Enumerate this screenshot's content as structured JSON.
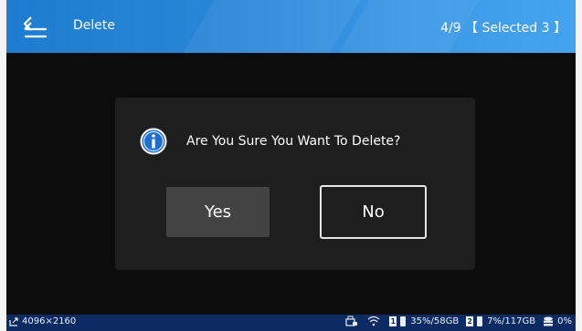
{
  "header": {
    "title": "Delete",
    "counter": "4/9",
    "selected": "【 Selected 3 】"
  },
  "dialog": {
    "message": "Are You Sure You Want To Delete?",
    "yes_label": "Yes",
    "no_label": "No",
    "icon": "info-icon"
  },
  "statusbar": {
    "resolution": "4096×2160",
    "slot1_number": "1",
    "slot1_usage": "35%/58GB",
    "slot2_number": "2",
    "slot2_usage": "7%/117GB",
    "storage_percent": "0%"
  },
  "colors": {
    "header_start": "#1e7ccf",
    "header_end": "#45a3ee",
    "statusbar": "#0d2b63",
    "dialog_bg": "#1e1e1e",
    "yes_bg": "#434343",
    "info_icon": "#1f6fd0"
  }
}
